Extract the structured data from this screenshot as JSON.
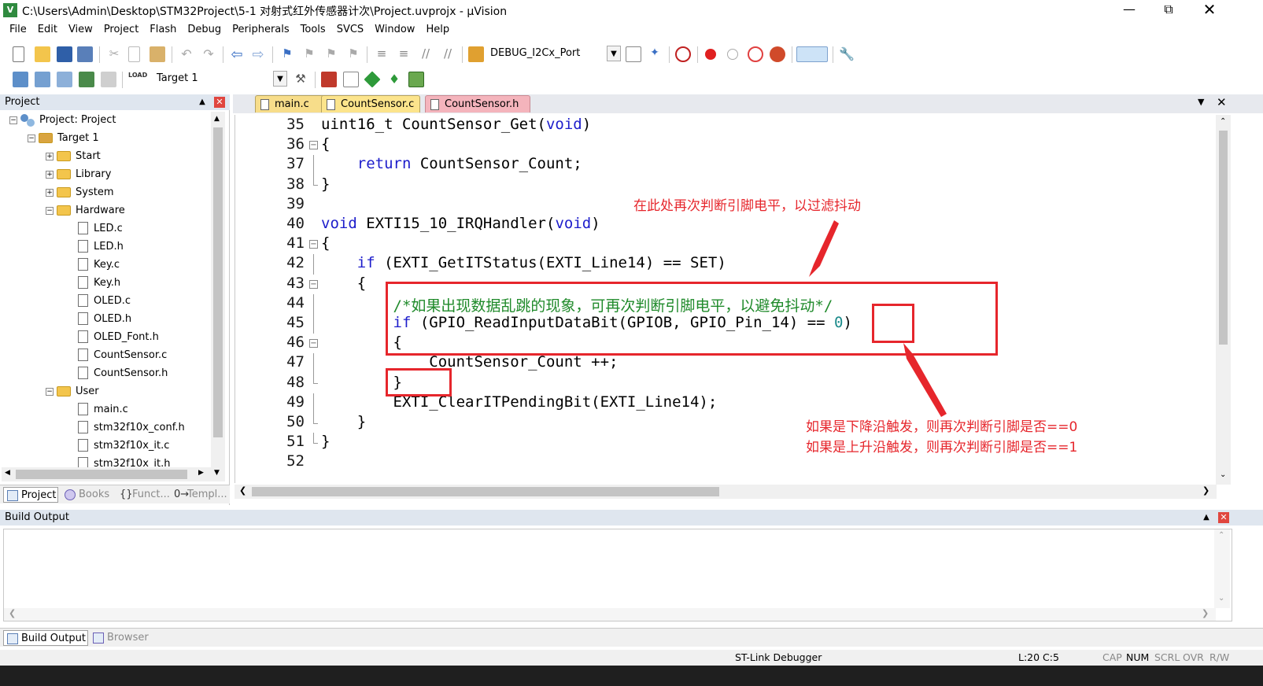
{
  "window": {
    "title": "C:\\Users\\Admin\\Desktop\\STM32Project\\5-1 对射式红外传感器计次\\Project.uvprojx - µVision",
    "app_icon": "V",
    "controls": [
      "minimize-icon",
      "restore-icon",
      "close-icon"
    ]
  },
  "menu": [
    "File",
    "Edit",
    "View",
    "Project",
    "Flash",
    "Debug",
    "Peripherals",
    "Tools",
    "SVCS",
    "Window",
    "Help"
  ],
  "toolbar": {
    "debug_combo": "DEBUG_I2Cx_Port",
    "target_combo": "Target 1",
    "load_label": "LOAD"
  },
  "project_panel": {
    "title": "Project",
    "tree": [
      {
        "label": "Project: Project",
        "kind": "project",
        "level": 0,
        "expander": "−"
      },
      {
        "label": "Target 1",
        "kind": "target",
        "level": 1,
        "expander": "−"
      },
      {
        "label": "Start",
        "kind": "folder",
        "level": 2,
        "expander": "+"
      },
      {
        "label": "Library",
        "kind": "folder",
        "level": 2,
        "expander": "+"
      },
      {
        "label": "System",
        "kind": "folder",
        "level": 2,
        "expander": "+"
      },
      {
        "label": "Hardware",
        "kind": "folder-open",
        "level": 2,
        "expander": "−"
      },
      {
        "label": "LED.c",
        "kind": "file",
        "level": 3
      },
      {
        "label": "LED.h",
        "kind": "file",
        "level": 3
      },
      {
        "label": "Key.c",
        "kind": "file",
        "level": 3
      },
      {
        "label": "Key.h",
        "kind": "file",
        "level": 3
      },
      {
        "label": "OLED.c",
        "kind": "file",
        "level": 3
      },
      {
        "label": "OLED.h",
        "kind": "file",
        "level": 3
      },
      {
        "label": "OLED_Font.h",
        "kind": "file",
        "level": 3
      },
      {
        "label": "CountSensor.c",
        "kind": "file",
        "level": 3
      },
      {
        "label": "CountSensor.h",
        "kind": "file",
        "level": 3
      },
      {
        "label": "User",
        "kind": "folder-open",
        "level": 2,
        "expander": "−"
      },
      {
        "label": "main.c",
        "kind": "file",
        "level": 3
      },
      {
        "label": "stm32f10x_conf.h",
        "kind": "file",
        "level": 3
      },
      {
        "label": "stm32f10x_it.c",
        "kind": "file",
        "level": 3
      },
      {
        "label": "stm32f10x_it.h",
        "kind": "file",
        "level": 3
      }
    ],
    "tabs": [
      {
        "label": "Project",
        "active": true
      },
      {
        "label": "Books",
        "active": false
      },
      {
        "label": "Funct...",
        "active": false
      },
      {
        "label": "Templ...",
        "active": false
      }
    ]
  },
  "editor": {
    "tabs": [
      {
        "label": "main.c",
        "active": false,
        "color": "#f7dd8a"
      },
      {
        "label": "CountSensor.c",
        "active": true,
        "color": "#fce48c"
      },
      {
        "label": "CountSensor.h",
        "active": false,
        "color": "#f4b4bc"
      }
    ],
    "lines": [
      {
        "no": "35",
        "fold": "",
        "code": [
          [
            "",
            "uint16_t CountSensor_Get("
          ],
          [
            "kw",
            "void"
          ],
          [
            "",
            ")"
          ]
        ]
      },
      {
        "no": "36",
        "fold": "box",
        "code": [
          [
            "",
            "{"
          ]
        ]
      },
      {
        "no": "37",
        "fold": "line",
        "code": [
          [
            "",
            "    "
          ],
          [
            "kw",
            "return"
          ],
          [
            "",
            " CountSensor_Count;"
          ]
        ]
      },
      {
        "no": "38",
        "fold": "end",
        "code": [
          [
            "",
            "}"
          ]
        ]
      },
      {
        "no": "39",
        "fold": "",
        "code": []
      },
      {
        "no": "40",
        "fold": "",
        "code": [
          [
            "kw",
            "void"
          ],
          [
            "",
            " EXTI15_10_IRQHandler("
          ],
          [
            "kw",
            "void"
          ],
          [
            "",
            ")"
          ]
        ]
      },
      {
        "no": "41",
        "fold": "box",
        "code": [
          [
            "",
            "{"
          ]
        ]
      },
      {
        "no": "42",
        "fold": "line",
        "code": [
          [
            "",
            "    "
          ],
          [
            "kw",
            "if"
          ],
          [
            "",
            " (EXTI_GetITStatus(EXTI_Line14) == SET)"
          ]
        ]
      },
      {
        "no": "43",
        "fold": "box",
        "code": [
          [
            "",
            "    {"
          ]
        ]
      },
      {
        "no": "44",
        "fold": "line",
        "code": [
          [
            "",
            "        "
          ],
          [
            "cm",
            "/*如果出现数据乱跳的现象，可再次判断引脚电平，以避免抖动*/"
          ]
        ]
      },
      {
        "no": "45",
        "fold": "line",
        "code": [
          [
            "",
            "        "
          ],
          [
            "kw",
            "if"
          ],
          [
            "",
            " (GPIO_ReadInputDataBit(GPIOB, GPIO_Pin_14) == "
          ],
          [
            "num",
            "0"
          ],
          [
            "",
            ")"
          ]
        ]
      },
      {
        "no": "46",
        "fold": "box",
        "code": [
          [
            "",
            "        {"
          ]
        ]
      },
      {
        "no": "47",
        "fold": "line",
        "code": [
          [
            "",
            "            CountSensor_Count ++;"
          ]
        ]
      },
      {
        "no": "48",
        "fold": "end",
        "code": [
          [
            "",
            "        }"
          ]
        ]
      },
      {
        "no": "49",
        "fold": "line",
        "code": [
          [
            "",
            "        EXTI_ClearITPendingBit(EXTI_Line14);"
          ]
        ]
      },
      {
        "no": "50",
        "fold": "end",
        "code": [
          [
            "",
            "    }"
          ]
        ]
      },
      {
        "no": "51",
        "fold": "end",
        "code": [
          [
            "",
            "}"
          ]
        ]
      },
      {
        "no": "52",
        "fold": "",
        "code": []
      }
    ]
  },
  "annotations": {
    "top_note": "在此处再次判断引脚电平，以过滤抖动",
    "bottom_note_1": "如果是下降沿触发，则再次判断引脚是否==0",
    "bottom_note_2": "如果是上升沿触发，则再次判断引脚是否==1",
    "color": "#e6262c"
  },
  "build_output": {
    "title": "Build Output",
    "tabs": [
      {
        "label": "Build Output",
        "active": true
      },
      {
        "label": "Browser",
        "active": false
      }
    ]
  },
  "statusbar": {
    "debugger": "ST-Link Debugger",
    "position": "L:20 C:5",
    "keys": [
      {
        "label": "CAP",
        "on": false
      },
      {
        "label": "NUM",
        "on": true
      },
      {
        "label": "SCRL",
        "on": false
      },
      {
        "label": "OVR",
        "on": false
      },
      {
        "label": "R/W",
        "on": false
      }
    ]
  }
}
